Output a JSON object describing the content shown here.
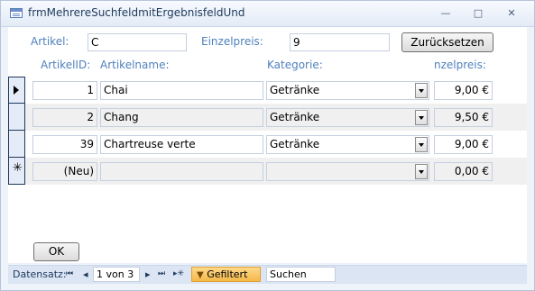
{
  "window": {
    "title": "frmMehrereSuchfeldmitErgebnisfeldUnd",
    "minimize_glyph": "—",
    "maximize_glyph": "□",
    "close_glyph": "✕"
  },
  "filters": {
    "artikel_label": "Artikel:",
    "artikel_value": "C",
    "einzelpreis_label": "Einzelpreis:",
    "einzelpreis_value": "9",
    "reset_button": "Zurücksetzen"
  },
  "headers": {
    "artikelid": "ArtikelID:",
    "artikelname": "Artikelname:",
    "kategorie": "Kategorie:",
    "einzelpreis": "nzelpreis:"
  },
  "rows": [
    {
      "id": "1",
      "name": "Chai",
      "category": "Getränke",
      "price": "9,00 €"
    },
    {
      "id": "2",
      "name": "Chang",
      "category": "Getränke",
      "price": "9,50 €"
    },
    {
      "id": "39",
      "name": "Chartreuse verte",
      "category": "Getränke",
      "price": "9,00 €"
    },
    {
      "id": "(Neu)",
      "name": "",
      "category": "",
      "price": "0,00 €"
    }
  ],
  "new_row_marker": "✳",
  "ok_button": "OK",
  "navigation": {
    "label": "Datensatz:",
    "first_glyph": "⏮",
    "prev_glyph": "◂",
    "position": "1 von 3",
    "next_glyph": "▸",
    "last_glyph": "⏭",
    "new_glyph": "▸✳",
    "filter_icon_glyph": "▼",
    "filter_status": "Gefiltert",
    "search_placeholder": "Suchen"
  },
  "colors": {
    "label_blue": "#4f81bd",
    "alt_row": "#f0f0f0",
    "filter_badge": "#f5b84a"
  }
}
